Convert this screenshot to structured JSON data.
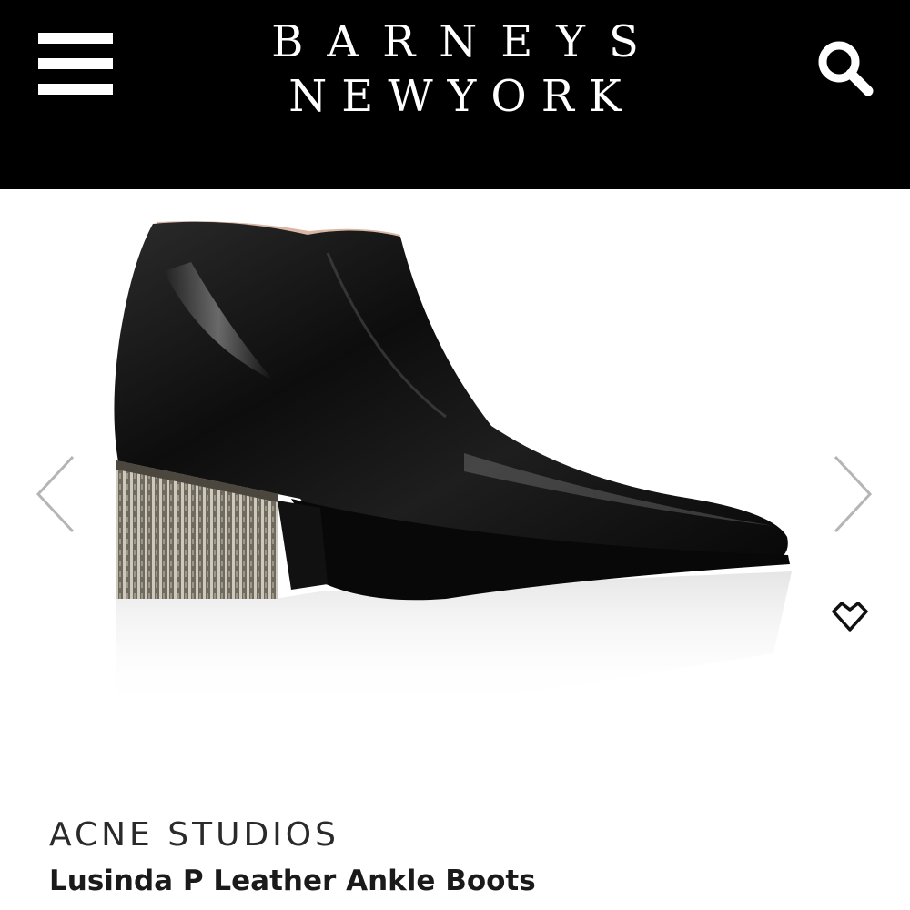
{
  "header": {
    "logo_line1": "BARNEYS",
    "logo_line2": "NEWYORK",
    "menu_icon": "hamburger-menu-icon",
    "search_icon": "search-icon",
    "background": "#000000",
    "foreground": "#ffffff"
  },
  "gallery": {
    "image_subject": "black leather ankle boot with chain-fringe heel",
    "prev_icon": "chevron-left-icon",
    "next_icon": "chevron-right-icon",
    "wishlist_icon": "heart-diamond-icon"
  },
  "product": {
    "brand": "ACNE STUDIOS",
    "name": "Lusinda P Leather Ankle Boots"
  }
}
